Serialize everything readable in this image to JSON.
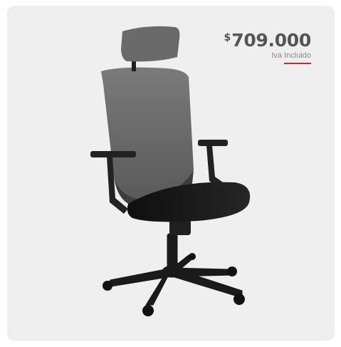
{
  "product": {
    "image_alt": "office chair",
    "price": {
      "currency_symbol": "$",
      "amount": "709.000",
      "tax_note": "Iva Incluido"
    }
  },
  "colors": {
    "card_bg": "#efefef",
    "price_text": "#555555",
    "accent": "#d8232a",
    "mesh": "#6d6d6d",
    "seat": "#181818"
  }
}
